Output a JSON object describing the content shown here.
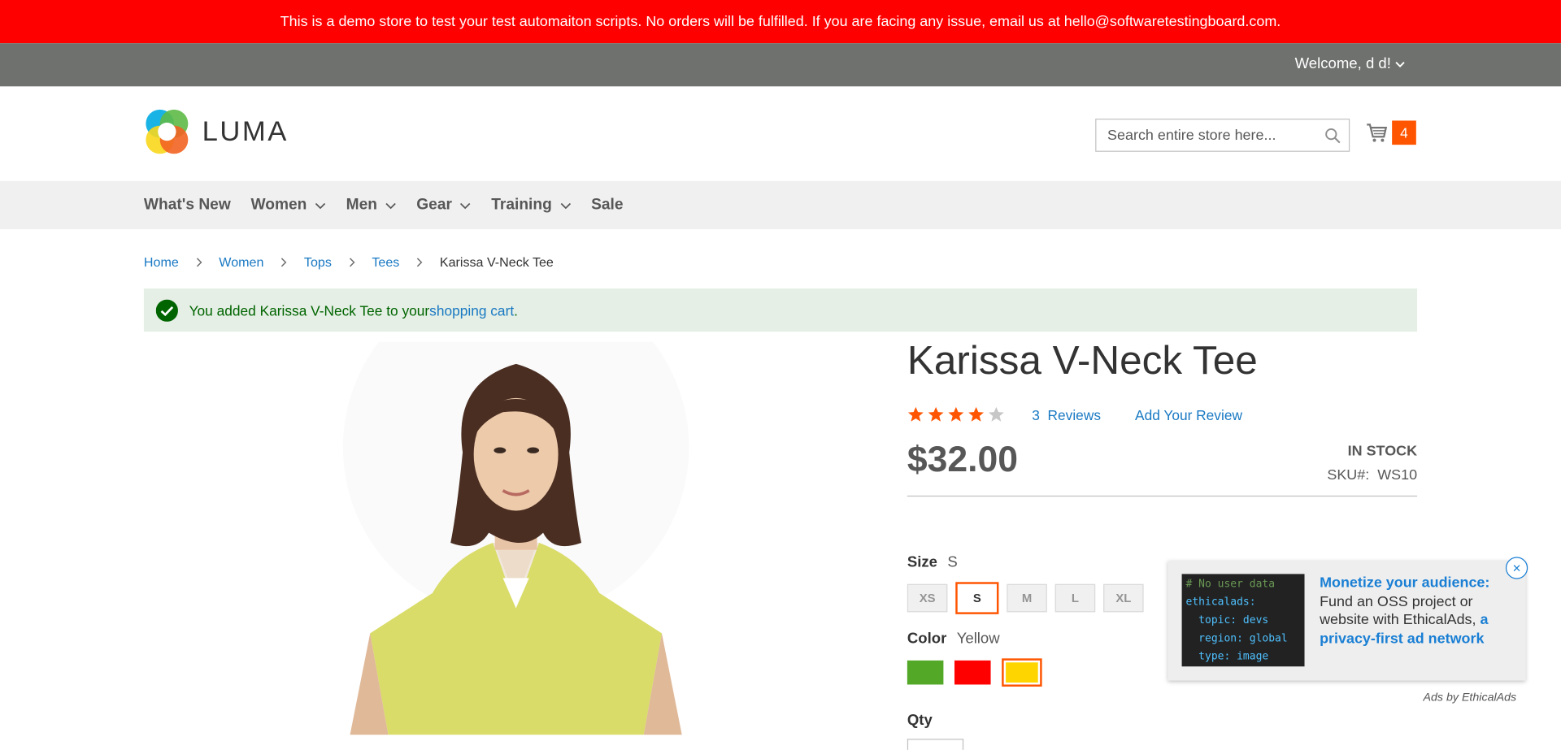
{
  "demo_banner": "This is a demo store to test your test automaiton scripts. No orders will be fulfilled. If you are facing any issue, email us at hello@softwaretestingboard.com.",
  "welcome": "Welcome, d d!",
  "logo_text": "LUMA",
  "search": {
    "placeholder": "Search entire store here..."
  },
  "cart": {
    "count": "4"
  },
  "nav": [
    "What's New",
    "Women",
    "Men",
    "Gear",
    "Training",
    "Sale"
  ],
  "breadcrumbs": [
    "Home",
    "Women",
    "Tops",
    "Tees",
    "Karissa V-Neck Tee"
  ],
  "message": {
    "prefix": "You added Karissa V-Neck Tee to your ",
    "link": "shopping cart",
    "suffix": "."
  },
  "product": {
    "title": "Karissa V-Neck Tee",
    "rating": 4,
    "rating_max": 5,
    "reviews_count": "3",
    "reviews_label": "Reviews",
    "add_review": "Add Your Review",
    "price": "$32.00",
    "stock": "IN STOCK",
    "sku_label": "SKU#:",
    "sku": "WS10"
  },
  "size": {
    "label": "Size",
    "selected": "S",
    "options": [
      "XS",
      "S",
      "M",
      "L",
      "XL"
    ]
  },
  "color": {
    "label": "Color",
    "selected": "Yellow",
    "swatches": [
      "#53a828",
      "#ff0000",
      "#ffd500"
    ]
  },
  "qty_label": "Qty",
  "ad": {
    "code_lines": [
      "# No user data",
      "ethicalads:",
      "  topic: devs",
      "  region: global",
      "  type: image"
    ],
    "headline": "Monetize your audience:",
    "body": "Fund an OSS project or website with EthicalAds,",
    "link": "a privacy-first ad network",
    "by": "Ads by EthicalAds"
  },
  "colors": {
    "brand_orange": "#ff5501",
    "link_blue": "#1979c3",
    "demo_red": "#ff0000"
  }
}
